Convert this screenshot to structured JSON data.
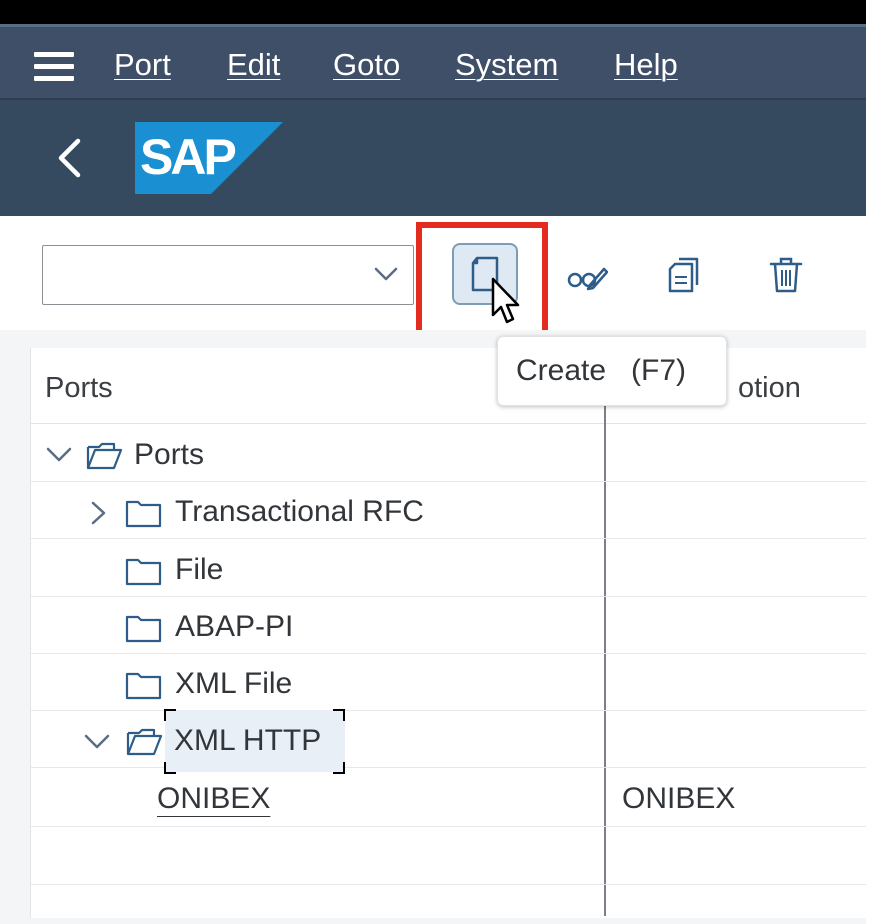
{
  "menubar": {
    "items": [
      {
        "label": "Port"
      },
      {
        "label": "Edit"
      },
      {
        "label": "Goto"
      },
      {
        "label": "System"
      },
      {
        "label": "Help"
      }
    ]
  },
  "shellbar": {
    "logo_text": "SAP"
  },
  "toolbar": {
    "dropdown_value": "",
    "highlighted_button": "create",
    "tooltip": "Create   (F7)"
  },
  "table": {
    "columns": [
      {
        "label": "Ports"
      },
      {
        "label": "Description",
        "visible_fragment": "otion"
      }
    ],
    "rows": [
      {
        "label": "Ports",
        "expanded": true,
        "level": 0,
        "description": ""
      },
      {
        "label": "Transactional RFC",
        "expanded": false,
        "level": 1,
        "description": ""
      },
      {
        "label": "File",
        "level": 1,
        "description": ""
      },
      {
        "label": "ABAP-PI",
        "level": 1,
        "description": ""
      },
      {
        "label": "XML File",
        "level": 1,
        "description": ""
      },
      {
        "label": "XML HTTP",
        "expanded": true,
        "level": 1,
        "selected": true,
        "description": ""
      },
      {
        "label": "ONIBEX",
        "level": 2,
        "description": "ONIBEX"
      }
    ]
  },
  "colors": {
    "menubar_bg": "#3e4f67",
    "shellbar_bg": "#354a5f",
    "highlight_border": "#e32b1f",
    "sap_logo": "#1a8fd1"
  }
}
